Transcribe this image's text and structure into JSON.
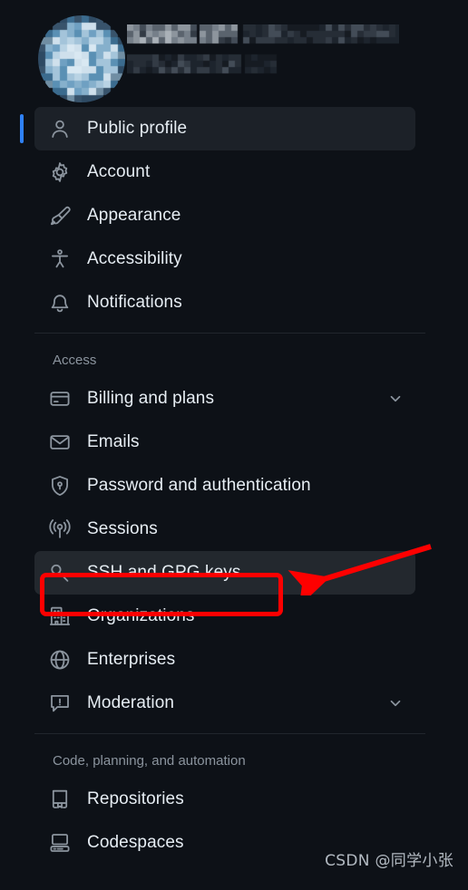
{
  "theme": {
    "background": "#0d1117",
    "active_row_bg": "#1c2128",
    "hover_row_bg": "#23282e",
    "accent": "#2f81f7",
    "text": "#e6edf3",
    "muted_text": "#8b949e",
    "divider": "#21262d",
    "annotation_red": "#fe0000"
  },
  "profile": {
    "avatar_label": "user-avatar-blurred",
    "display_name_redacted": "",
    "username_redacted": ""
  },
  "nav": {
    "primary": [
      {
        "label": "Public profile",
        "icon": "person-icon",
        "state": "active",
        "chevron": false
      },
      {
        "label": "Account",
        "icon": "gear-icon",
        "state": "normal",
        "chevron": false
      },
      {
        "label": "Appearance",
        "icon": "paintbrush-icon",
        "state": "normal",
        "chevron": false
      },
      {
        "label": "Accessibility",
        "icon": "accessibility-icon",
        "state": "normal",
        "chevron": false
      },
      {
        "label": "Notifications",
        "icon": "bell-icon",
        "state": "normal",
        "chevron": false
      }
    ],
    "sections": [
      {
        "title": "Access",
        "items": [
          {
            "label": "Billing and plans",
            "icon": "credit-card-icon",
            "state": "normal",
            "chevron": true
          },
          {
            "label": "Emails",
            "icon": "mail-icon",
            "state": "normal",
            "chevron": false
          },
          {
            "label": "Password and authentication",
            "icon": "shield-lock-icon",
            "state": "normal",
            "chevron": false
          },
          {
            "label": "Sessions",
            "icon": "broadcast-icon",
            "state": "normal",
            "chevron": false
          },
          {
            "label": "SSH and GPG keys",
            "icon": "key-icon",
            "state": "hovered",
            "chevron": false
          },
          {
            "label": "Organizations",
            "icon": "organization-icon",
            "state": "normal",
            "chevron": false
          },
          {
            "label": "Enterprises",
            "icon": "globe-icon",
            "state": "normal",
            "chevron": false
          },
          {
            "label": "Moderation",
            "icon": "report-icon",
            "state": "normal",
            "chevron": true
          }
        ]
      },
      {
        "title": "Code, planning, and automation",
        "items": [
          {
            "label": "Repositories",
            "icon": "repo-icon",
            "state": "normal",
            "chevron": false
          },
          {
            "label": "Codespaces",
            "icon": "codespaces-icon",
            "state": "normal",
            "chevron": false
          }
        ]
      }
    ]
  },
  "annotations": {
    "highlight_target": "SSH and GPG keys",
    "arrow_label": "red-pointer-arrow"
  },
  "watermark": {
    "text": "CSDN @同学小张"
  }
}
